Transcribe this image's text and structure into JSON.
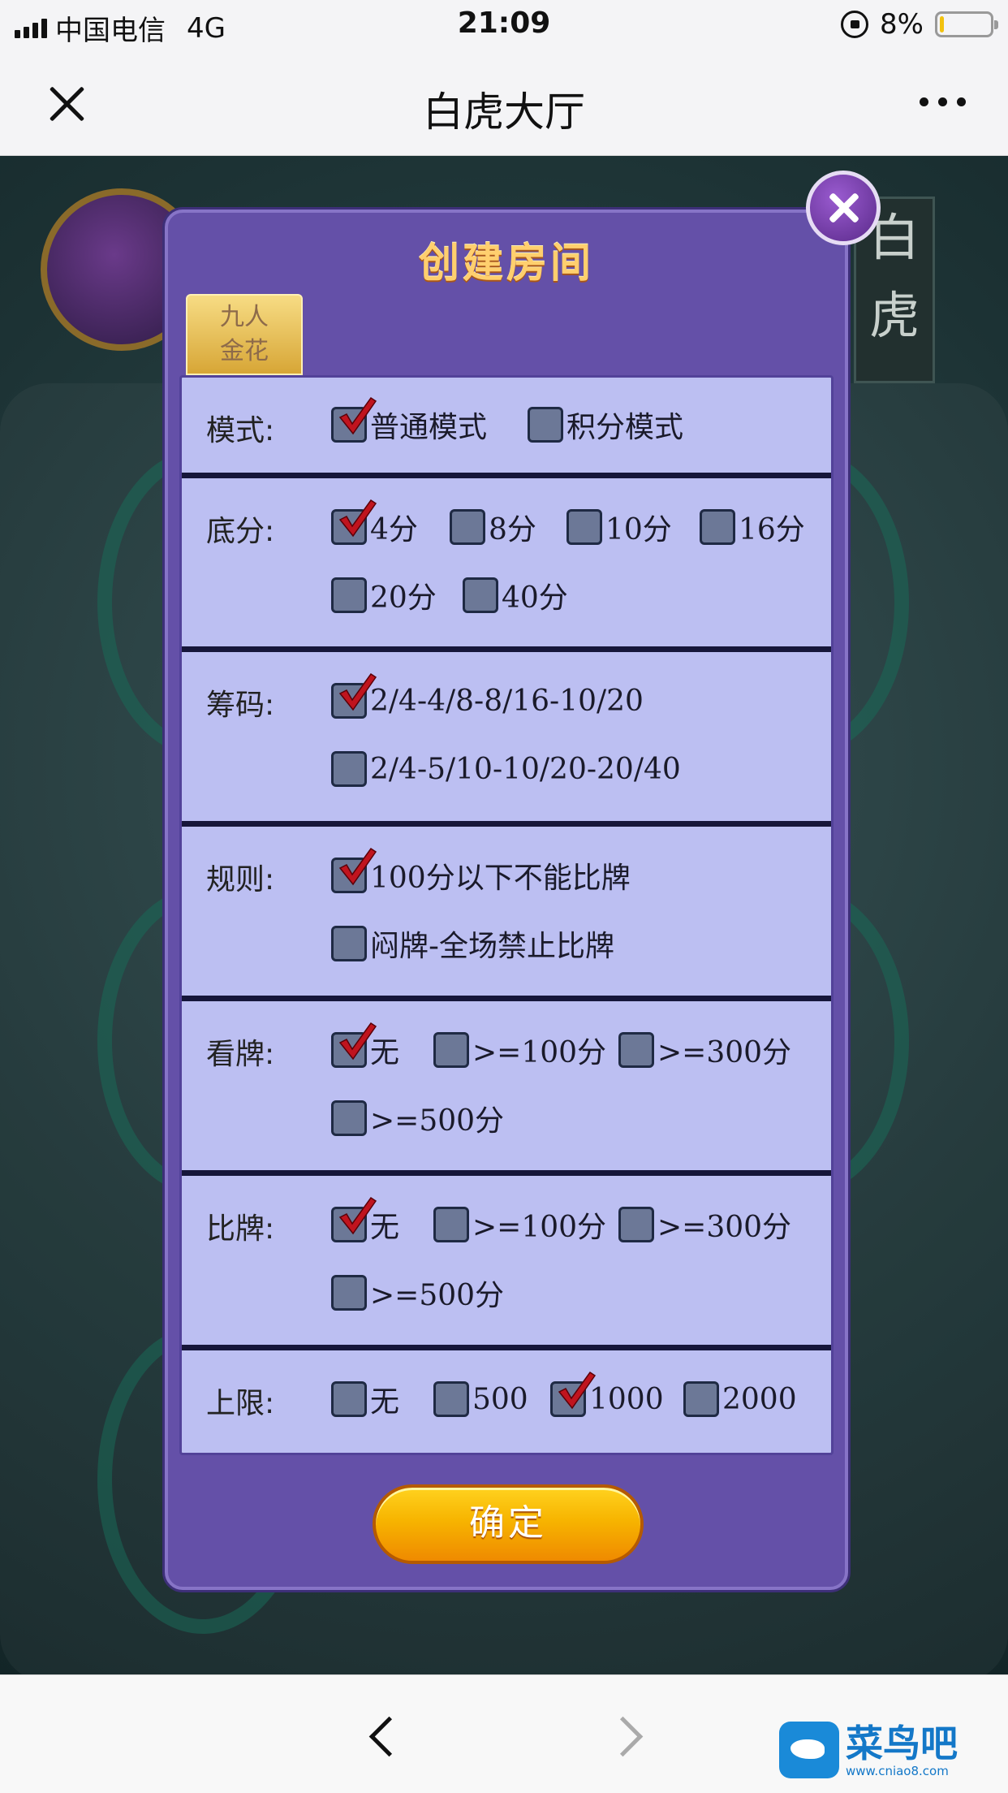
{
  "status_bar": {
    "carrier": "中国电信",
    "network": "4G",
    "time": "21:09",
    "battery": "8%",
    "battery_level": 0.08,
    "battery_color": "#f2c20f"
  },
  "nav": {
    "title": "白虎大厅",
    "close_icon": "close-icon",
    "more_icon": "more-icon"
  },
  "background": {
    "side_sign": [
      "白",
      "虎"
    ]
  },
  "dialog": {
    "title": "创建房间",
    "tab_label_line1": "九人",
    "tab_label_line2": "金花",
    "confirm_label": "确定",
    "accent_color": "#6450a8",
    "check_color": "#c0141e",
    "sections": [
      {
        "label": "模式:",
        "options": [
          {
            "text": "普通模式",
            "checked": true
          },
          {
            "text": "积分模式",
            "checked": false
          }
        ]
      },
      {
        "label": "底分:",
        "options": [
          {
            "text": "4分",
            "checked": true
          },
          {
            "text": "8分",
            "checked": false
          },
          {
            "text": "10分",
            "checked": false
          },
          {
            "text": "16分",
            "checked": false
          },
          {
            "text": "20分",
            "checked": false
          },
          {
            "text": "40分",
            "checked": false
          }
        ]
      },
      {
        "label": "筹码:",
        "options": [
          {
            "text": "2/4-4/8-8/16-10/20",
            "checked": true
          },
          {
            "text": "2/4-5/10-10/20-20/40",
            "checked": false
          }
        ]
      },
      {
        "label": "规则:",
        "options": [
          {
            "text": "100分以下不能比牌",
            "checked": true
          },
          {
            "text": "闷牌-全场禁止比牌",
            "checked": false
          }
        ]
      },
      {
        "label": "看牌:",
        "options": [
          {
            "text": "无",
            "checked": true
          },
          {
            "text": ">=100分",
            "checked": false
          },
          {
            "text": ">=300分",
            "checked": false
          },
          {
            "text": ">=500分",
            "checked": false
          }
        ]
      },
      {
        "label": "比牌:",
        "options": [
          {
            "text": "无",
            "checked": true
          },
          {
            "text": ">=100分",
            "checked": false
          },
          {
            "text": ">=300分",
            "checked": false
          },
          {
            "text": ">=500分",
            "checked": false
          }
        ]
      },
      {
        "label": "上限:",
        "options": [
          {
            "text": "无",
            "checked": false
          },
          {
            "text": "500",
            "checked": false
          },
          {
            "text": "1000",
            "checked": true
          },
          {
            "text": "2000",
            "checked": false
          }
        ]
      }
    ]
  },
  "bottom_bar": {
    "back_icon": "chevron-left-icon",
    "forward_icon": "chevron-right-icon",
    "watermark_text": "菜鸟吧",
    "watermark_url": "www.cniao8.com"
  }
}
